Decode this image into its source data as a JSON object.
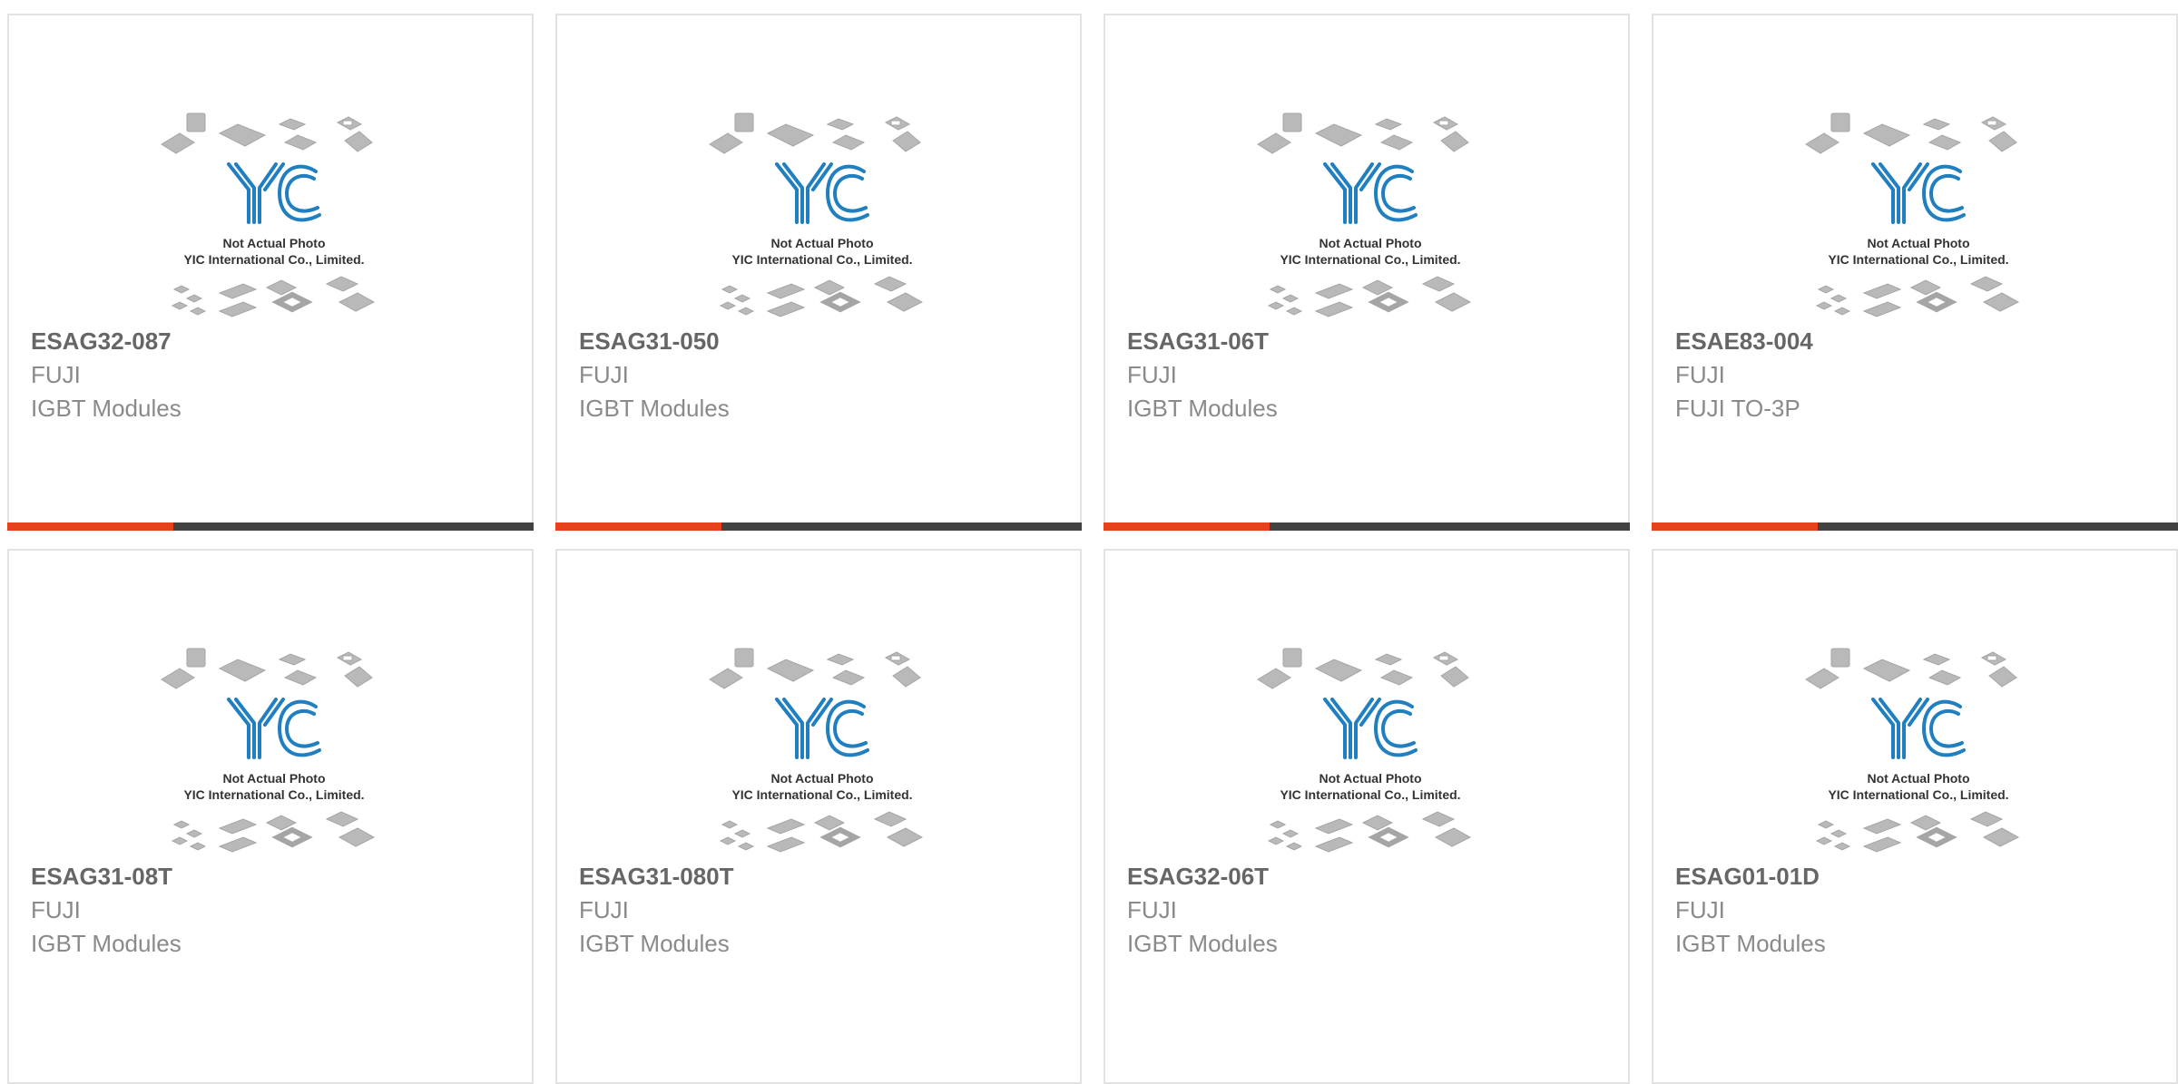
{
  "products": [
    {
      "part": "ESAG32-087",
      "manufacturer": "FUJI",
      "category": "IGBT Modules"
    },
    {
      "part": "ESAG31-050",
      "manufacturer": "FUJI",
      "category": "IGBT Modules"
    },
    {
      "part": "ESAG31-06T",
      "manufacturer": "FUJI",
      "category": "IGBT Modules"
    },
    {
      "part": "ESAE83-004",
      "manufacturer": "FUJI",
      "category": "FUJI TO-3P"
    },
    {
      "part": "ESAG31-08T",
      "manufacturer": "FUJI",
      "category": "IGBT Modules"
    },
    {
      "part": "ESAG31-080T",
      "manufacturer": "FUJI",
      "category": "IGBT Modules"
    },
    {
      "part": "ESAG32-06T",
      "manufacturer": "FUJI",
      "category": "IGBT Modules"
    },
    {
      "part": "ESAG01-01D",
      "manufacturer": "FUJI",
      "category": "IGBT Modules"
    }
  ],
  "placeholder": {
    "logo_text": "YIC",
    "line1": "Not Actual Photo",
    "line2": "YIC International Co., Limited."
  },
  "colors": {
    "accent": "#e7411b",
    "bar": "#424242",
    "logo_blue": "#1f7fc0",
    "title_text": "#666666",
    "meta_text": "#8a8a8a"
  }
}
